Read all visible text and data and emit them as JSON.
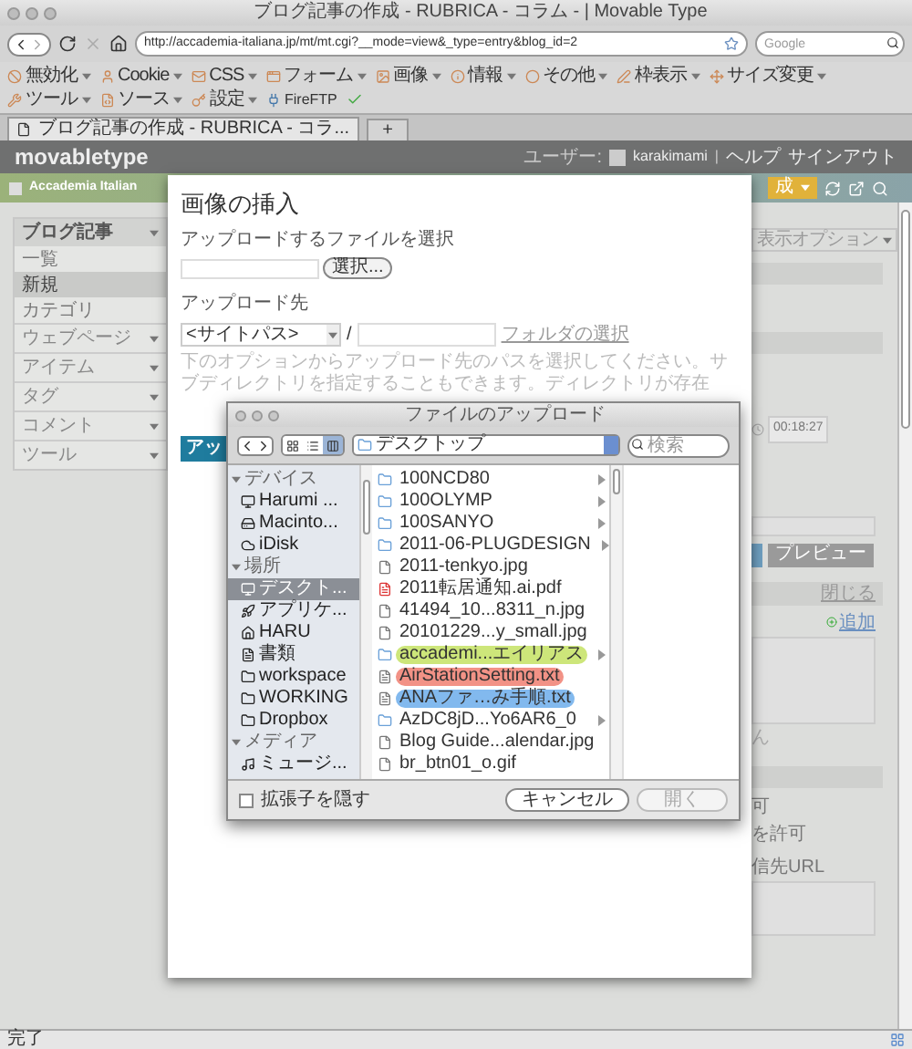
{
  "browser": {
    "title": "ブログ記事の作成 - RUBRICA - コラム - | Movable Type",
    "url": "http://accademia-italiana.jp/mt/mt.cgi?__mode=view&_type=entry&blog_id=2",
    "search": {
      "placeholder": "Google"
    }
  },
  "toolbar": [
    {
      "label": "無効化"
    },
    {
      "label": "Cookie"
    },
    {
      "label": "CSS"
    },
    {
      "label": "フォーム"
    },
    {
      "label": "画像"
    },
    {
      "label": "情報"
    },
    {
      "label": "その他"
    },
    {
      "label": "枠表示"
    },
    {
      "label": "サイズ変更"
    },
    {
      "label": "ツール"
    },
    {
      "label": "ソース"
    },
    {
      "label": "設定"
    }
  ],
  "fireftp": "FireFTP",
  "tabs": [
    {
      "label": "ブログ記事の作成 - RUBRICA - コラ...",
      "selected": true
    }
  ],
  "new_tab": "+",
  "mt": {
    "logo": "movabletype",
    "user_label": "ユーザー:",
    "user": "karakimami",
    "separator": "|",
    "help": "ヘルプ",
    "signout": "サインアウト",
    "blog": "Accademia Italian",
    "create_button": "成"
  },
  "sidebar": {
    "header": "ブログ記事",
    "items": [
      {
        "label": "一覧",
        "selected": false
      },
      {
        "label": "新規",
        "selected": true
      },
      {
        "label": "カテゴリ",
        "selected": false
      }
    ],
    "groups": [
      "ウェブページ",
      "アイテム",
      "タグ",
      "コメント",
      "ツール"
    ]
  },
  "right": {
    "display_options": "表示オプション",
    "time": "00:18:27",
    "preview": "プレビュー",
    "close": "閉じる",
    "add": "追加",
    "fragment_1": "ん",
    "fragment_2": "可",
    "fragment_3": "を許可",
    "fragment_4": "信先URL"
  },
  "modal": {
    "title": "画像の挿入",
    "file_label": "アップロードするファイルを選択",
    "choose_button": "選択...",
    "dest_label": "アップロード先",
    "dest_select": "<サイトパス>",
    "slash": "/",
    "folder_link": "フォルダの選択",
    "hint": "下のオプションからアップロード先のパスを選択してください。サブディレクトリを指定することもできます。ディレクトリが存在",
    "upload_button": "アッ"
  },
  "file_dialog": {
    "title": "ファイルのアップロード",
    "location": "デスクトップ",
    "search": {
      "placeholder": "検索"
    },
    "views": [
      {
        "selected": false
      },
      {
        "selected": false
      },
      {
        "selected": true
      }
    ],
    "sidebar": [
      {
        "title": "デバイス",
        "items": [
          {
            "label": "Harumi ...",
            "selected": false
          },
          {
            "label": "Macinto...",
            "selected": false
          },
          {
            "label": "iDisk",
            "selected": false
          }
        ]
      },
      {
        "title": "場所",
        "items": [
          {
            "label": "デスクト...",
            "selected": true
          },
          {
            "label": "アプリケ...",
            "selected": false
          },
          {
            "label": "HARU",
            "selected": false
          },
          {
            "label": "書類",
            "selected": false
          },
          {
            "label": "workspace",
            "selected": false
          },
          {
            "label": "WORKING",
            "selected": false
          },
          {
            "label": "Dropbox",
            "selected": false
          }
        ]
      },
      {
        "title": "メディア",
        "items": [
          {
            "label": "ミュージ...",
            "selected": false
          }
        ]
      }
    ],
    "files": [
      {
        "name": "100NCD80",
        "kind": "folder"
      },
      {
        "name": "100OLYMP",
        "kind": "folder"
      },
      {
        "name": "100SANYO",
        "kind": "folder"
      },
      {
        "name": "2011-06-PLUGDESIGN",
        "kind": "folder"
      },
      {
        "name": "2011-tenkyo.jpg",
        "kind": "file"
      },
      {
        "name": "2011転居通知.ai.pdf",
        "kind": "pdf"
      },
      {
        "name": "41494_10...8311_n.jpg",
        "kind": "file"
      },
      {
        "name": "20101229...y_small.jpg",
        "kind": "file"
      },
      {
        "name": "accademi...エイリアス",
        "kind": "folder",
        "color": "#cde67a"
      },
      {
        "name": "AirStationSetting.txt",
        "kind": "text",
        "color": "#f29286"
      },
      {
        "name": "ANAファ…み手順.txt",
        "kind": "text",
        "color": "#82b9ee"
      },
      {
        "name": "AzDC8jD...Yo6AR6_0",
        "kind": "folder"
      },
      {
        "name": "Blog Guide...alendar.jpg",
        "kind": "file"
      },
      {
        "name": "br_btn01_o.gif",
        "kind": "file"
      }
    ],
    "hide_extension": {
      "label": "拡張子を隠す",
      "checked": false
    },
    "cancel": "キャンセル",
    "open": {
      "label": "開く",
      "disabled": true
    }
  },
  "status_bar": "完了"
}
